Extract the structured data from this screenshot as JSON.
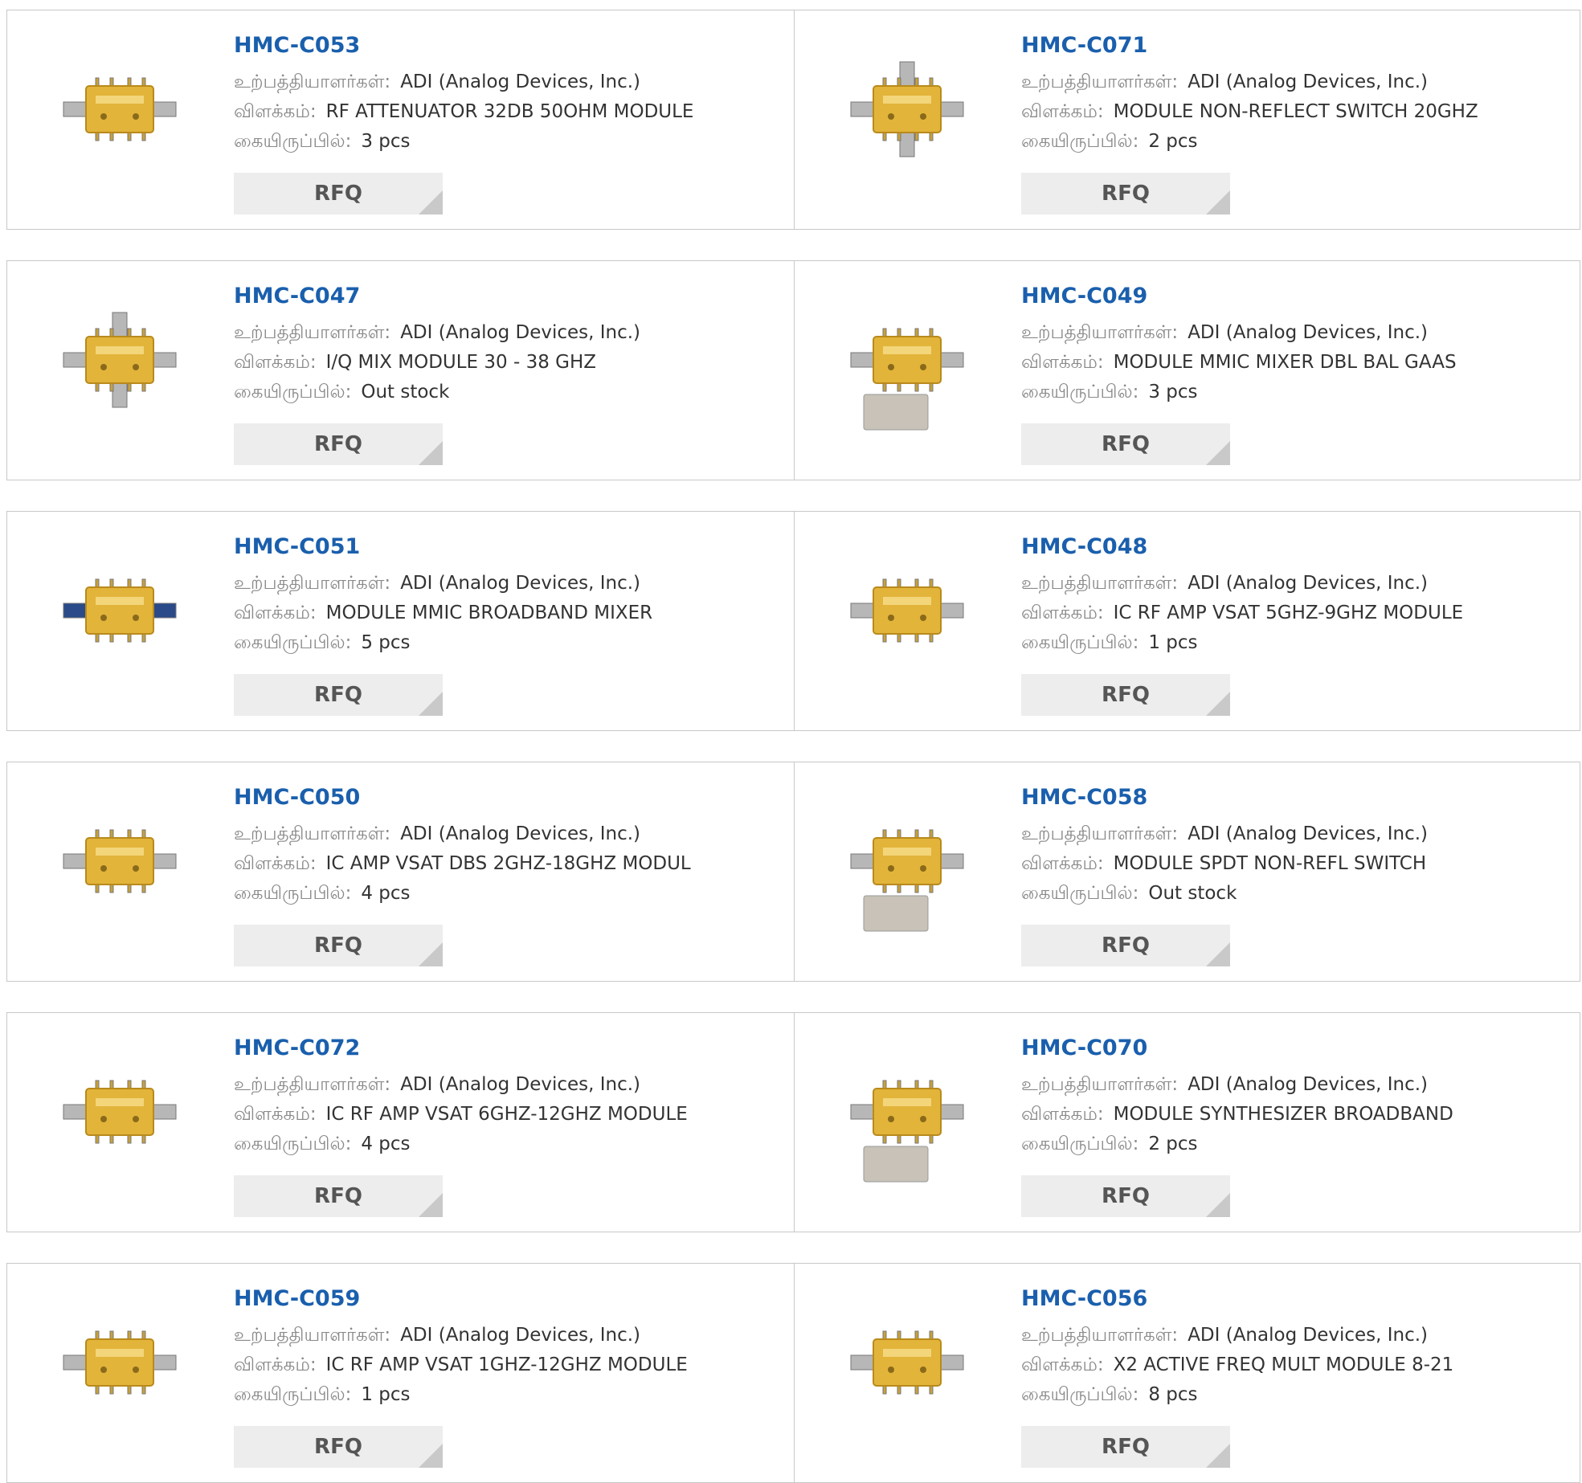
{
  "labels": {
    "manufacturer": "உற்பத்தியாளர்கள்:",
    "description": "விளக்கம்:",
    "stock": "கையிருப்பில்:",
    "rfq": "RFQ"
  },
  "products": [
    {
      "part": "HMC-C053",
      "manufacturer": "ADI (Analog Devices, Inc.)",
      "description": "RF ATTENUATOR 32DB 50OHM MODULE",
      "stock": "3 pcs",
      "image": "module-4pin-icon"
    },
    {
      "part": "HMC-C071",
      "manufacturer": "ADI (Analog Devices, Inc.)",
      "description": "MODULE NON-REFLECT SWITCH 20GHZ",
      "stock": "2 pcs",
      "image": "module-octagon-icon"
    },
    {
      "part": "HMC-C047",
      "manufacturer": "ADI (Analog Devices, Inc.)",
      "description": "I/Q MIX MODULE 30 - 38 GHZ",
      "stock": "Out stock",
      "image": "module-cross-icon"
    },
    {
      "part": "HMC-C049",
      "manufacturer": "ADI (Analog Devices, Inc.)",
      "description": "MODULE MMIC MIXER DBL BAL GAAS",
      "stock": "3 pcs",
      "image": "module-with-lid-icon"
    },
    {
      "part": "HMC-C051",
      "manufacturer": "ADI (Analog Devices, Inc.)",
      "description": "MODULE MMIC BROADBAND MIXER",
      "stock": "5 pcs",
      "image": "module-blue-connectors-icon"
    },
    {
      "part": "HMC-C048",
      "manufacturer": "ADI (Analog Devices, Inc.)",
      "description": "IC RF AMP VSAT 5GHZ-9GHZ MODULE",
      "stock": "1 pcs",
      "image": "module-4pin-icon"
    },
    {
      "part": "HMC-C050",
      "manufacturer": "ADI (Analog Devices, Inc.)",
      "description": "IC AMP VSAT DBS 2GHZ-18GHZ MODUL",
      "stock": "4 pcs",
      "image": "module-small-icon"
    },
    {
      "part": "HMC-C058",
      "manufacturer": "ADI (Analog Devices, Inc.)",
      "description": "MODULE SPDT NON-REFL SWITCH",
      "stock": "Out stock",
      "image": "module-with-lid-icon"
    },
    {
      "part": "HMC-C072",
      "manufacturer": "ADI (Analog Devices, Inc.)",
      "description": "IC RF AMP VSAT 6GHZ-12GHZ MODULE",
      "stock": "4 pcs",
      "image": "module-tilted-icon"
    },
    {
      "part": "HMC-C070",
      "manufacturer": "ADI (Analog Devices, Inc.)",
      "description": "MODULE SYNTHESIZER BROADBAND",
      "stock": "2 pcs",
      "image": "module-with-lid-icon"
    },
    {
      "part": "HMC-C059",
      "manufacturer": "ADI (Analog Devices, Inc.)",
      "description": "IC RF AMP VSAT 1GHZ-12GHZ MODULE",
      "stock": "1 pcs",
      "image": "module-4pin-icon"
    },
    {
      "part": "HMC-C056",
      "manufacturer": "ADI (Analog Devices, Inc.)",
      "description": "X2 ACTIVE FREQ MULT MODULE 8-21",
      "stock": "8 pcs",
      "image": "module-4pin-icon"
    }
  ],
  "colors": {
    "link": "#1a5fad",
    "module_gold": "#e2b43a",
    "border": "#c8c8c8",
    "button_bg": "#ededed"
  }
}
